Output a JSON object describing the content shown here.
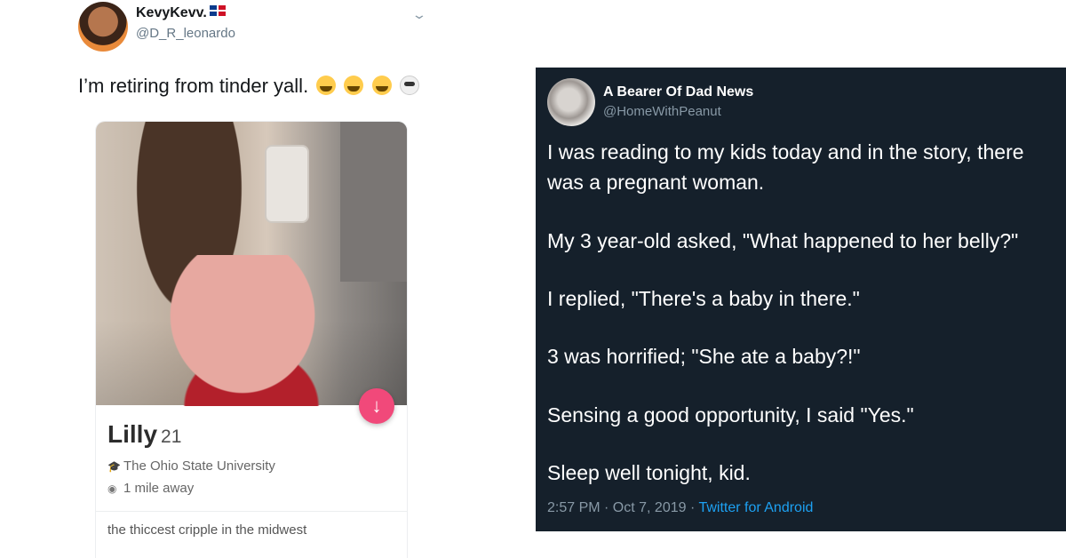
{
  "left_tweet": {
    "author_name": "KevyKevv.",
    "handle": "@D_R_leonardo",
    "text": "I’m retiring from tinder yall.",
    "emojis": [
      "tears-of-joy",
      "tears-of-joy",
      "tears-of-joy",
      "skull"
    ],
    "profile": {
      "name": "Lilly",
      "age": "21",
      "school": "The Ohio State University",
      "distance": "1 mile away",
      "bio": "the thiccest cripple in the midwest"
    }
  },
  "right_tweet": {
    "author_name": "A Bearer Of Dad News",
    "handle": "@HomeWithPeanut",
    "lines": {
      "l1": "I was reading to my kids today and in the story, there",
      "l2": "was a pregnant woman.",
      "l3": "My 3 year-old asked, \"What happened to her belly?\"",
      "l4": "I replied, \"There's a baby in there.\"",
      "l5": "3 was horrified; \"She ate a baby?!\"",
      "l6": "Sensing a good opportunity, I said \"Yes.\"",
      "l7": "Sleep well tonight, kid."
    },
    "time": "2:57 PM · Oct 7, 2019 · ",
    "source": "Twitter for Android"
  },
  "colors": {
    "dark_bg": "#15202b",
    "link": "#1da1f2",
    "tinder_pink": "#f1497a"
  }
}
